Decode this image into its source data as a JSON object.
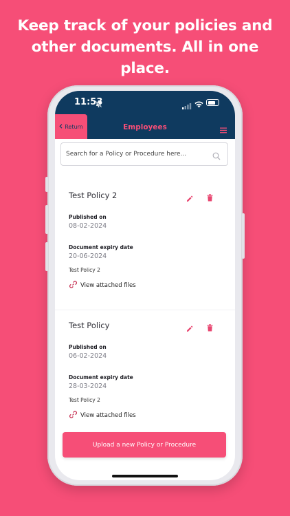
{
  "headline": {
    "line1": "Keep track of your policies and",
    "line2": "other documents. All in one",
    "line3": "place."
  },
  "status_bar": {
    "time": "11:53"
  },
  "nav": {
    "return_label": "Return",
    "title": "Employees"
  },
  "search": {
    "placeholder": "Search for a Policy or Procedure here..."
  },
  "policies": [
    {
      "title": "Test Policy 2",
      "published_label": "Published on",
      "published_date": "08-02-2024",
      "expiry_label": "Document expiry date",
      "expiry_date": "20-06-2024",
      "description": "Test Policy 2",
      "files_label": "View attached files"
    },
    {
      "title": "Test Policy",
      "published_label": "Published on",
      "published_date": "06-02-2024",
      "expiry_label": "Document expiry date",
      "expiry_date": "28-03-2024",
      "description": "Test Policy 2",
      "files_label": "View attached files"
    }
  ],
  "upload_button_label": "Upload a new Policy or Procedure",
  "colors": {
    "background": "#F64E77",
    "navbar": "#0F3A5F",
    "accent": "#F64E77",
    "text_dark": "#1d1d24",
    "text_muted": "#7c7c86"
  },
  "icons": [
    "bell-muted-icon",
    "signal-icon",
    "wifi-icon",
    "battery-icon",
    "chevron-left-icon",
    "menu-icon",
    "search-icon",
    "edit-icon",
    "delete-icon",
    "link-icon"
  ]
}
